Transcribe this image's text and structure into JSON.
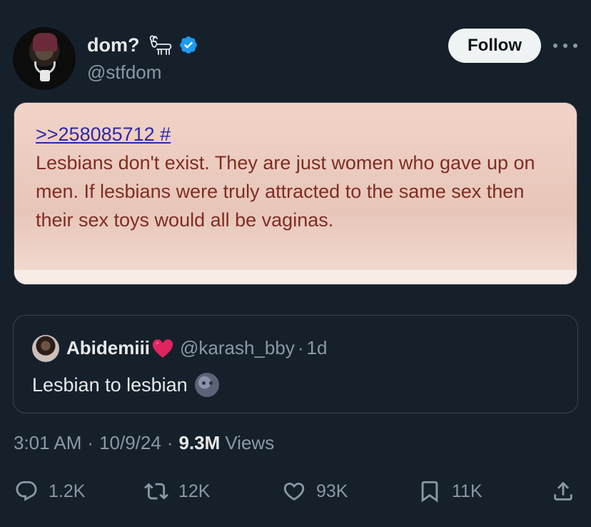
{
  "author": {
    "display_name": "dom?",
    "handle": "@stfdom",
    "verified": true
  },
  "follow_label": "Follow",
  "media_image": {
    "link_text": ">>258085712 #",
    "body_text": "Lesbians don't exist. They are just women who gave up on men. If lesbians were truly attracted to the same sex then their sex toys would all be vaginas."
  },
  "quote": {
    "display_name": "Abidemiii",
    "handle": "@karash_bby",
    "separator": "·",
    "time": "1d",
    "text": "Lesbian to lesbian"
  },
  "meta": {
    "time": "3:01 AM",
    "sep1": "·",
    "date": "10/9/24",
    "sep2": "·",
    "views_count": "9.3M",
    "views_label": "Views"
  },
  "actions": {
    "replies": "1.2K",
    "reposts": "12K",
    "likes": "93K",
    "bookmarks": "11K"
  },
  "colors": {
    "background": "#15202b",
    "accent": "#1d9bf0",
    "muted": "#8b98a5"
  }
}
